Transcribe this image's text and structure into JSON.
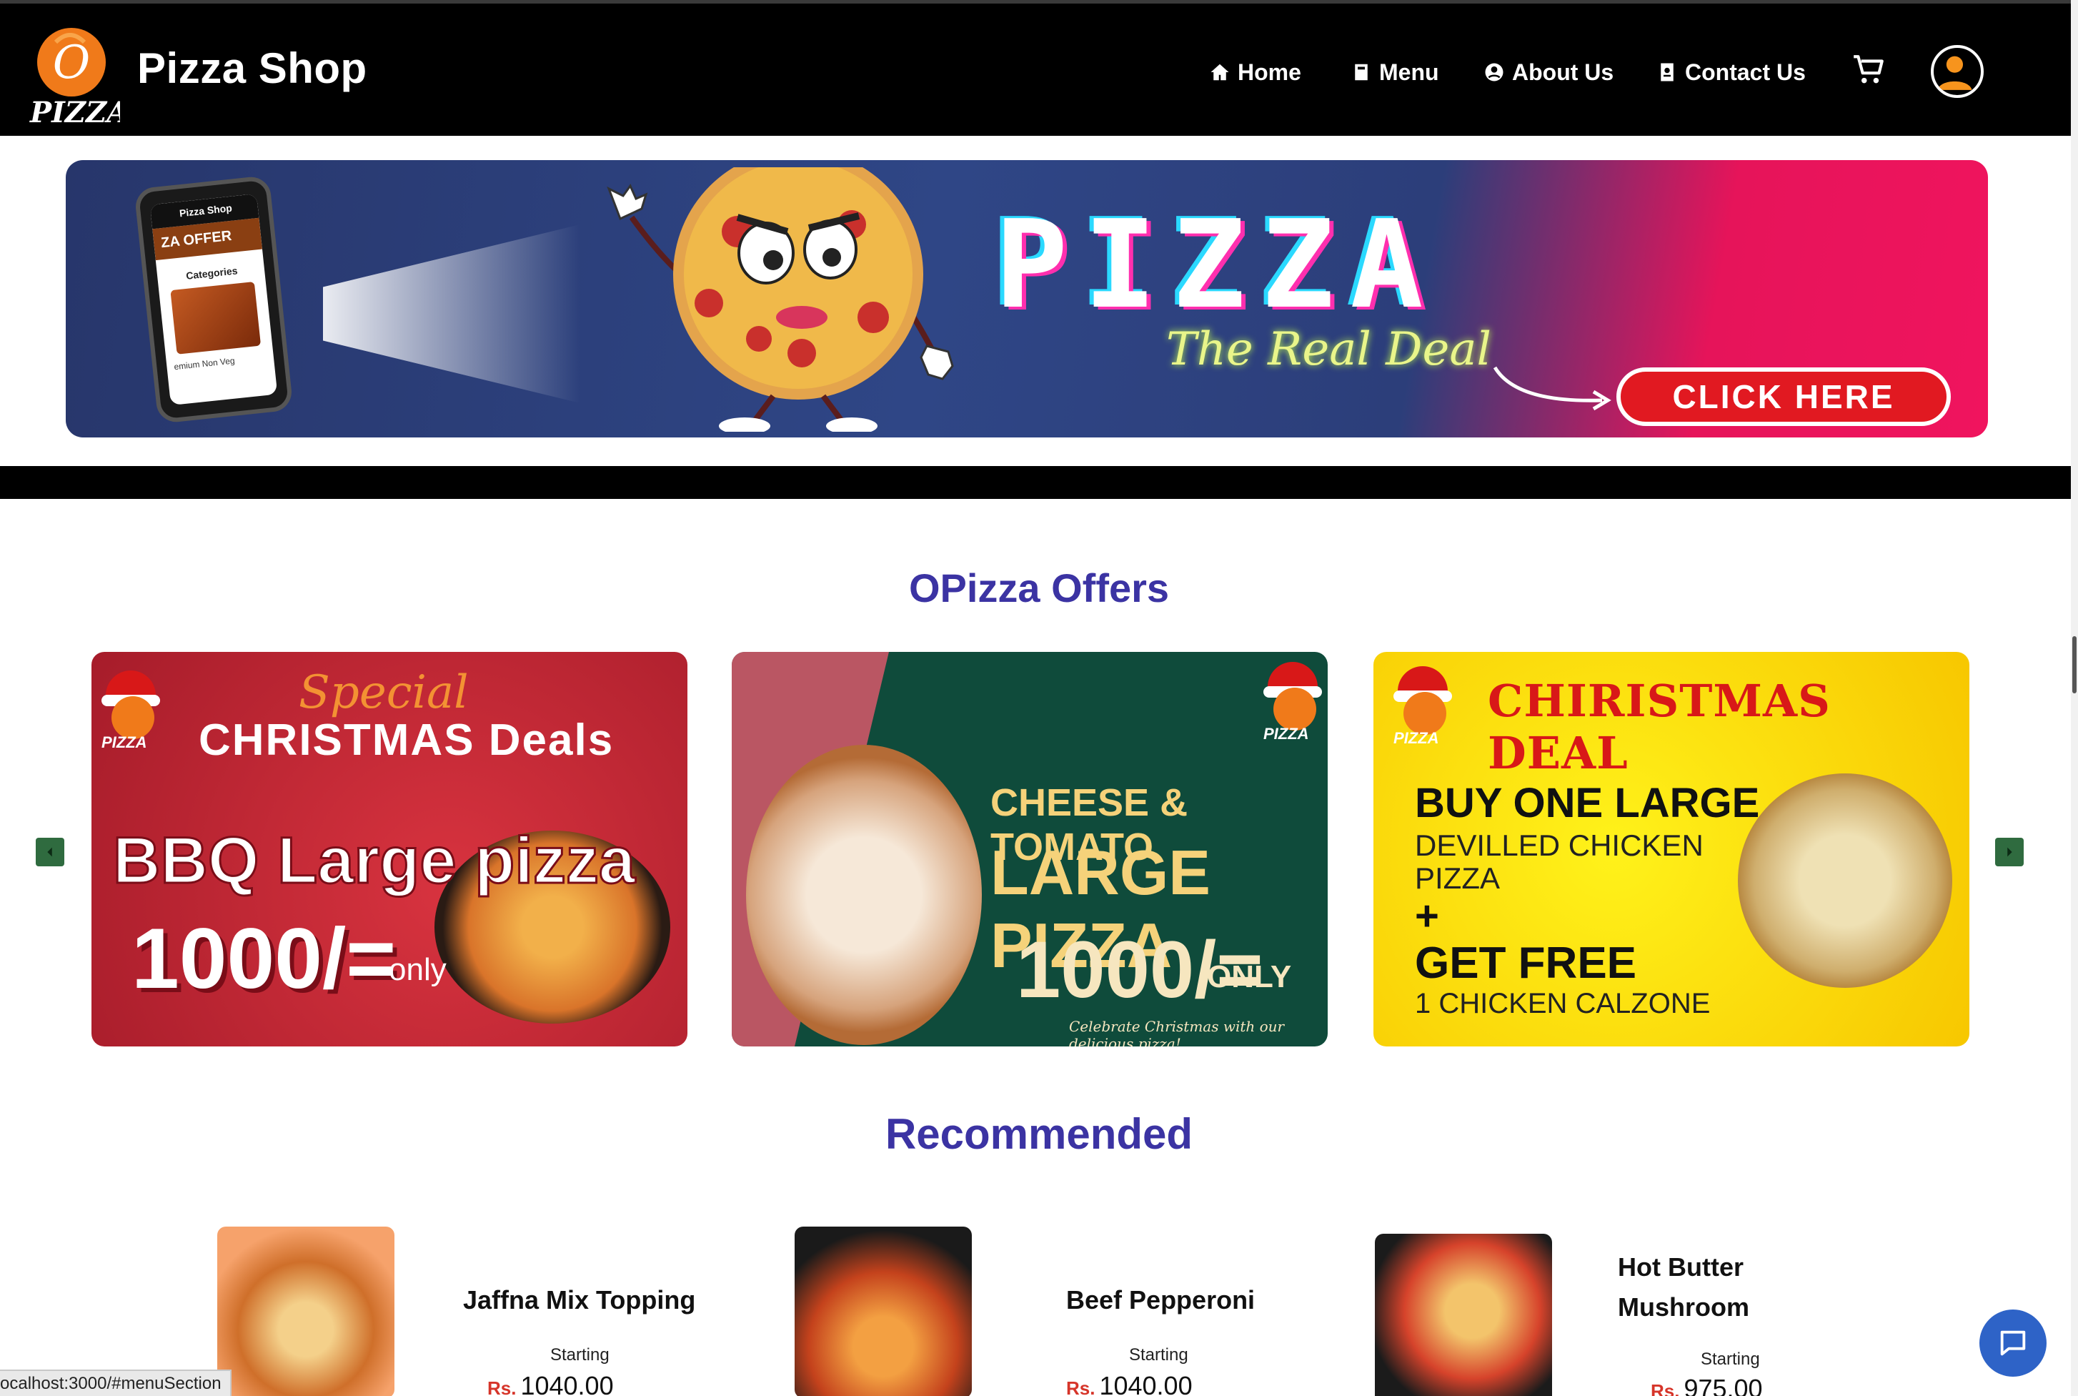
{
  "brand": {
    "name": "Pizza Shop",
    "logo_text": "PIZZA",
    "logo_letter": "O"
  },
  "nav": {
    "items": [
      {
        "label": "Home",
        "icon": "home-icon"
      },
      {
        "label": "Menu",
        "icon": "book-icon"
      },
      {
        "label": "About Us",
        "icon": "user-circle-icon"
      },
      {
        "label": "Contact Us",
        "icon": "address-book-icon"
      }
    ],
    "cart_icon": "cart-icon",
    "profile_icon": "avatar-icon"
  },
  "banner": {
    "headline": "PIZZA",
    "tagline": "The Real Deal",
    "cta": "CLICK HERE",
    "phone": {
      "shop": "Pizza Shop",
      "offer": "ZA OFFER",
      "categories": "Categories",
      "footer": "emium Non Veg"
    }
  },
  "offers": {
    "title": "OPizza Offers",
    "cards": [
      {
        "line1": "Special",
        "line2": "CHRISTMAS Deals",
        "line3": "BBQ Large pizza",
        "price": "1000/=",
        "suffix": "only"
      },
      {
        "line1": "CHEESE & TOMATO",
        "line2": "LARGE PIZZA",
        "price": "1000/=",
        "suffix": "ONLY",
        "footer": "Celebrate Christmas with our delicious pizza!"
      },
      {
        "title": "CHIRISTMAS DEAL",
        "line1": "BUY ONE LARGE",
        "line2": "DEVILLED CHICKEN",
        "line3": "PIZZA",
        "plus": "+",
        "line4": "GET FREE",
        "line5": "1 CHICKEN CALZONE"
      }
    ]
  },
  "recommended": {
    "title": "Recommended",
    "items": [
      {
        "name": "Jaffna Mix Topping",
        "starting": "Starting",
        "currency": "Rs.",
        "price": "1040.00"
      },
      {
        "name": "Beef Pepperoni",
        "starting": "Starting",
        "currency": "Rs.",
        "price": "1040.00"
      },
      {
        "name_line1": "Hot Butter",
        "name_line2": "Mushroom",
        "starting": "Starting",
        "currency": "Rs.",
        "price": "975.00"
      }
    ]
  },
  "status_bar": {
    "url": "ocalhost:3000/#menuSection"
  },
  "colors": {
    "accent": "#3b33a3",
    "price": "#d6352a",
    "nav_bg": "#000000",
    "chat": "#2e63c7"
  }
}
